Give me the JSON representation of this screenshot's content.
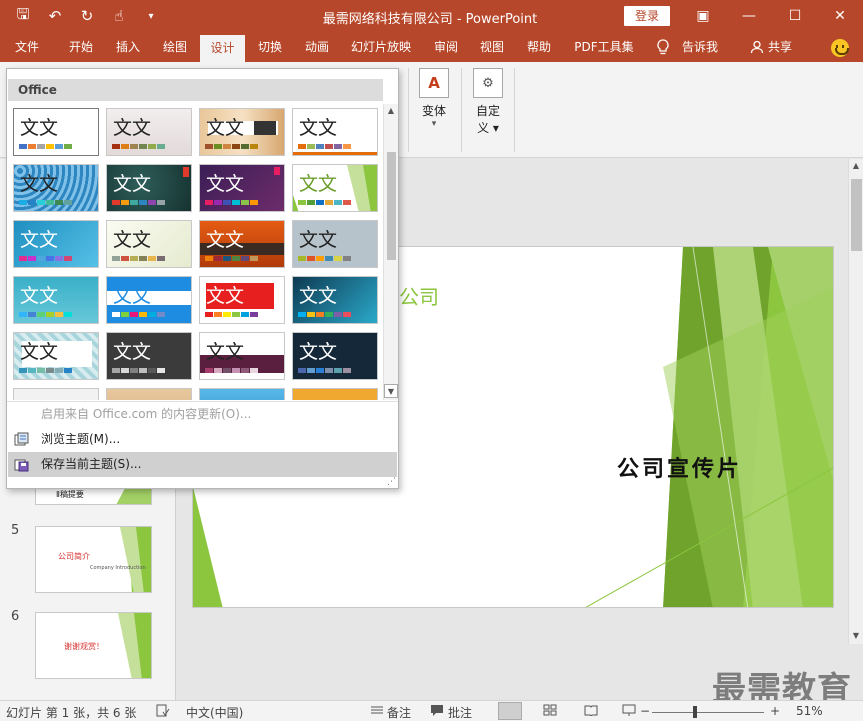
{
  "window": {
    "title": "最需网络科技有限公司  -  PowerPoint",
    "login_label": "登录",
    "controls": {
      "ribbon_display": "▣",
      "minimize": "—",
      "maximize": "☐",
      "close": "✕"
    }
  },
  "qat": {
    "save": "🖫",
    "undo": "↶",
    "redo": "↻",
    "touch": "☝",
    "more": "▾"
  },
  "tabs": [
    "文件",
    "开始",
    "插入",
    "绘图",
    "设计",
    "切换",
    "动画",
    "幻灯片放映",
    "审阅",
    "视图",
    "帮助",
    "PDF工具集"
  ],
  "active_tab": "设计",
  "tellme": "告诉我",
  "share": "共享",
  "ribbon": {
    "variants_label": "变体",
    "variants_dropdown": "▾",
    "customize_label_line1": "自定",
    "customize_label_line2": "义 ▾"
  },
  "dropdown": {
    "header": "Office",
    "theme_text": "文文",
    "menu_items": [
      {
        "label": "启用来自 Office.com 的内容更新(O)...",
        "disabled": true
      },
      {
        "label": "浏览主题(M)...",
        "disabled": false
      },
      {
        "label": "保存当前主题(S)...",
        "disabled": false
      }
    ],
    "resize_grip": "⋰",
    "scroll_up": "▲",
    "scroll_down": "▼"
  },
  "slide": {
    "company_partial": "公司",
    "title": "公司宣传片"
  },
  "thumbnails": [
    {
      "number": "5",
      "title": "公司简介",
      "subtitle": "Company Introduction"
    },
    {
      "number": "6",
      "title": "谢谢观赏！"
    }
  ],
  "thumbnail_partial": "Ⅱ稿提要",
  "status": {
    "slide_info": "幻灯片 第 1 张，共 6 张",
    "language": "中文(中国)",
    "notes": "备注",
    "comments": "批注",
    "zoom_minus": "−",
    "zoom_plus": "+",
    "zoom": "51%"
  },
  "watermark": "最需教育",
  "colors": {
    "accent": "#b7472a",
    "slide_green": "#8cc63f"
  }
}
